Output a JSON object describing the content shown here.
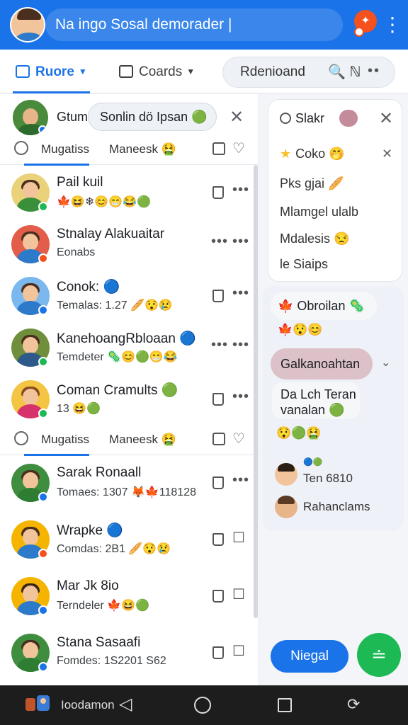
{
  "topbar": {
    "search_text": "Na ingo Sosal demorader |",
    "notif_icon": "fire-icon",
    "more_icon": "⋮"
  },
  "tabs": [
    {
      "label": "Ruore",
      "active": true
    },
    {
      "label": "Coards",
      "active": false
    }
  ],
  "tab_search": {
    "text": "Rdenioand",
    "icon": "🔍 ℕ",
    "dots": "••"
  },
  "left_panel": {
    "header_title": "Gtum",
    "header_chip": "Sonlin dö Ipsan 🟢",
    "subtabs": [
      "Mugatiss",
      "Maneesk 🤮"
    ],
    "rows": [
      {
        "name": "Pail kuil",
        "sub": "🍁😆❄😊😁😂🟢",
        "badge_color": "#1db954",
        "shirt": "#3a8f3a",
        "bg": "#e9d27a",
        "r2": "•••"
      },
      {
        "name": "Stnalay Alakuaitar",
        "sub": "Eonabs",
        "badge_color": "#f4511e",
        "shirt": "#2c7ac9",
        "bg": "#e25d4a",
        "r2": "•••"
      },
      {
        "name": "Conok: 🔵",
        "sub": "Temalas: 1.27 🥖😯😢",
        "badge_color": "#1a73e8",
        "shirt": "#2c7ac9",
        "bg": "#7ab8ee",
        "r2": "•••"
      },
      {
        "name": "KanehoangRbloaan 🔵",
        "sub": "Temdeter 🦠😊🟢😁😂",
        "badge_color": "#1db954",
        "shirt": "#2d5a8a",
        "bg": "#6f8f3c",
        "r2": "•••"
      },
      {
        "name": "Coman Cramults 🟢",
        "sub": "13 😆🟢",
        "badge_color": "#1db954",
        "shirt": "#d6336c",
        "bg": "#f4c542",
        "r2": "•••"
      },
      {
        "name": "Sarak Ronaall",
        "sub": "Tomaes: 1307 🦊🍁118128",
        "badge_color": "#1a73e8",
        "shirt": "#2e7d32",
        "bg": "#3f8e3f",
        "r2": "•••"
      },
      {
        "name": "Wrapke 🔵",
        "sub": "Comdas: 2B1 🥖😯😢",
        "badge_color": "#f4511e",
        "shirt": "#2c7ac9",
        "bg": "#f4b400",
        "r2": "☐"
      },
      {
        "name": "Mar Jk 8io",
        "sub": "Terndeler 🍁😆🟢",
        "badge_color": "#1a73e8",
        "shirt": "#2c7ac9",
        "bg": "#f4b400",
        "r2": "☐"
      },
      {
        "name": "Stana Sasaafi",
        "sub": "Fomdes: 1S2201 S62",
        "badge_color": "#1a73e8",
        "shirt": "#2e7d32",
        "bg": "#3f8e3f",
        "r2": "☐"
      }
    ]
  },
  "right_card": {
    "head": "Slakr",
    "items": [
      "Coko 🤭",
      "Pks gjai 🥖",
      "Mlamgel ulalb",
      "Mdalesis 😒",
      "le Siaips"
    ]
  },
  "right_chat": {
    "bubble1": "🍁 Obroilan 🦠",
    "emoji1": "🍁😯😊",
    "bubble2": "Galkanoahtan",
    "bubble3_line1": "Da Lch Teran",
    "bubble3_line2": "vanalan 🟢",
    "emoji2": "😯🟢🤮",
    "mini_tag": "🔵🟢",
    "contact1": "Ten 6810",
    "contact2": "Rahanclams"
  },
  "fab": {
    "label": "Niegal",
    "icon": "≐"
  },
  "navbar": {
    "text": "Ioodamon",
    "back": "◁"
  },
  "colors": {
    "accent": "#1a73e8",
    "fab_green": "#1db954",
    "notif": "#f4511e"
  }
}
